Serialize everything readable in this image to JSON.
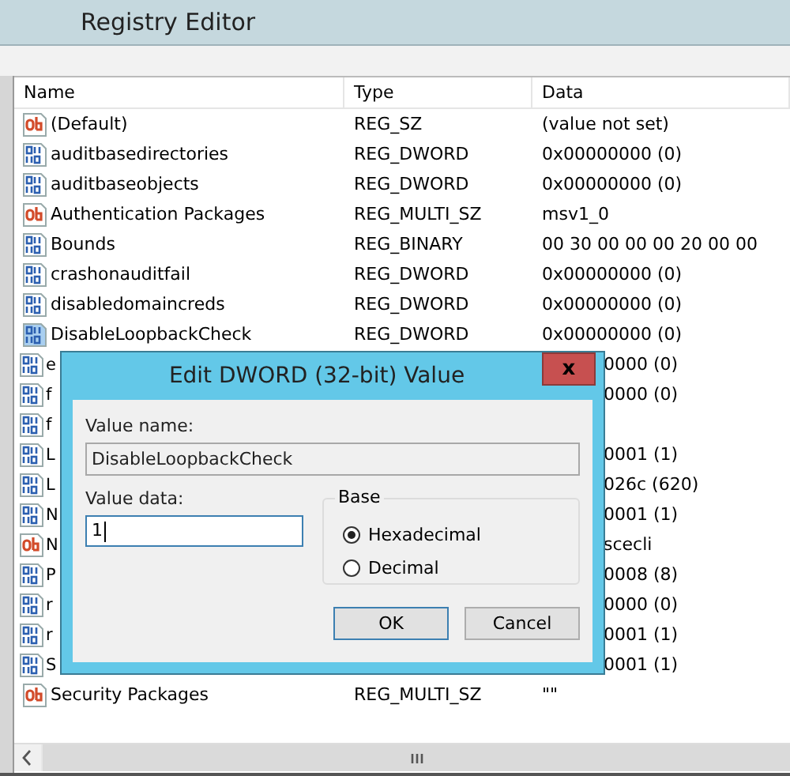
{
  "window": {
    "title": "Registry Editor"
  },
  "table": {
    "columns": [
      "Name",
      "Type",
      "Data"
    ],
    "rows": [
      {
        "kind": "string",
        "covered": false,
        "selected": false,
        "name": "(Default)",
        "type": "REG_SZ",
        "data": "(value not set)"
      },
      {
        "kind": "binary",
        "covered": false,
        "selected": false,
        "name": "auditbasedirectories",
        "type": "REG_DWORD",
        "data": "0x00000000 (0)"
      },
      {
        "kind": "binary",
        "covered": false,
        "selected": false,
        "name": "auditbaseobjects",
        "type": "REG_DWORD",
        "data": "0x00000000 (0)"
      },
      {
        "kind": "string",
        "covered": false,
        "selected": false,
        "name": "Authentication Packages",
        "type": "REG_MULTI_SZ",
        "data": "msv1_0"
      },
      {
        "kind": "binary",
        "covered": false,
        "selected": false,
        "name": "Bounds",
        "type": "REG_BINARY",
        "data": "00 30 00 00 00 20 00 00"
      },
      {
        "kind": "binary",
        "covered": false,
        "selected": false,
        "name": "crashonauditfail",
        "type": "REG_DWORD",
        "data": "0x00000000 (0)"
      },
      {
        "kind": "binary",
        "covered": false,
        "selected": false,
        "name": "disabledomaincreds",
        "type": "REG_DWORD",
        "data": "0x00000000 (0)"
      },
      {
        "kind": "binary",
        "covered": false,
        "selected": true,
        "name": "DisableLoopbackCheck",
        "type": "REG_DWORD",
        "data": "0x00000000 (0)"
      },
      {
        "kind": "binary",
        "covered": true,
        "selected": false,
        "name": "e",
        "data": "0000 (0)"
      },
      {
        "kind": "binary",
        "covered": true,
        "selected": false,
        "name": "f",
        "data": "0000 (0)"
      },
      {
        "kind": "binary",
        "covered": true,
        "selected": false,
        "name": "f"
      },
      {
        "kind": "binary",
        "covered": true,
        "selected": false,
        "name": "L",
        "data": "0001 (1)"
      },
      {
        "kind": "binary",
        "covered": true,
        "selected": false,
        "name": "L",
        "data": "026c (620)"
      },
      {
        "kind": "binary",
        "covered": true,
        "selected": false,
        "name": "N",
        "data": "0001 (1)"
      },
      {
        "kind": "string",
        "covered": true,
        "selected": false,
        "name": "N",
        "data": "scecli"
      },
      {
        "kind": "binary",
        "covered": true,
        "selected": false,
        "name": "P",
        "data": "0008 (8)"
      },
      {
        "kind": "binary",
        "covered": true,
        "selected": false,
        "name": "r",
        "data": "0000 (0)"
      },
      {
        "kind": "binary",
        "covered": true,
        "selected": false,
        "name": "r",
        "data": "0001 (1)"
      },
      {
        "kind": "binary",
        "covered": true,
        "selected": false,
        "name": "S",
        "data": "0001 (1)"
      },
      {
        "kind": "string",
        "covered": false,
        "selected": false,
        "name": "Security Packages",
        "type": "REG_MULTI_SZ",
        "data": "\"\""
      }
    ]
  },
  "dialog": {
    "title": "Edit DWORD (32-bit) Value",
    "close": "x",
    "value_name_label": "Value name:",
    "value_name": "DisableLoopbackCheck",
    "value_data_label": "Value data:",
    "value_data": "1",
    "base": {
      "label": "Base",
      "options": [
        {
          "label": "Hexadecimal",
          "selected": true
        },
        {
          "label": "Decimal",
          "selected": false
        }
      ]
    },
    "buttons": [
      {
        "label": "OK",
        "default": true
      },
      {
        "label": "Cancel",
        "default": false
      }
    ]
  }
}
